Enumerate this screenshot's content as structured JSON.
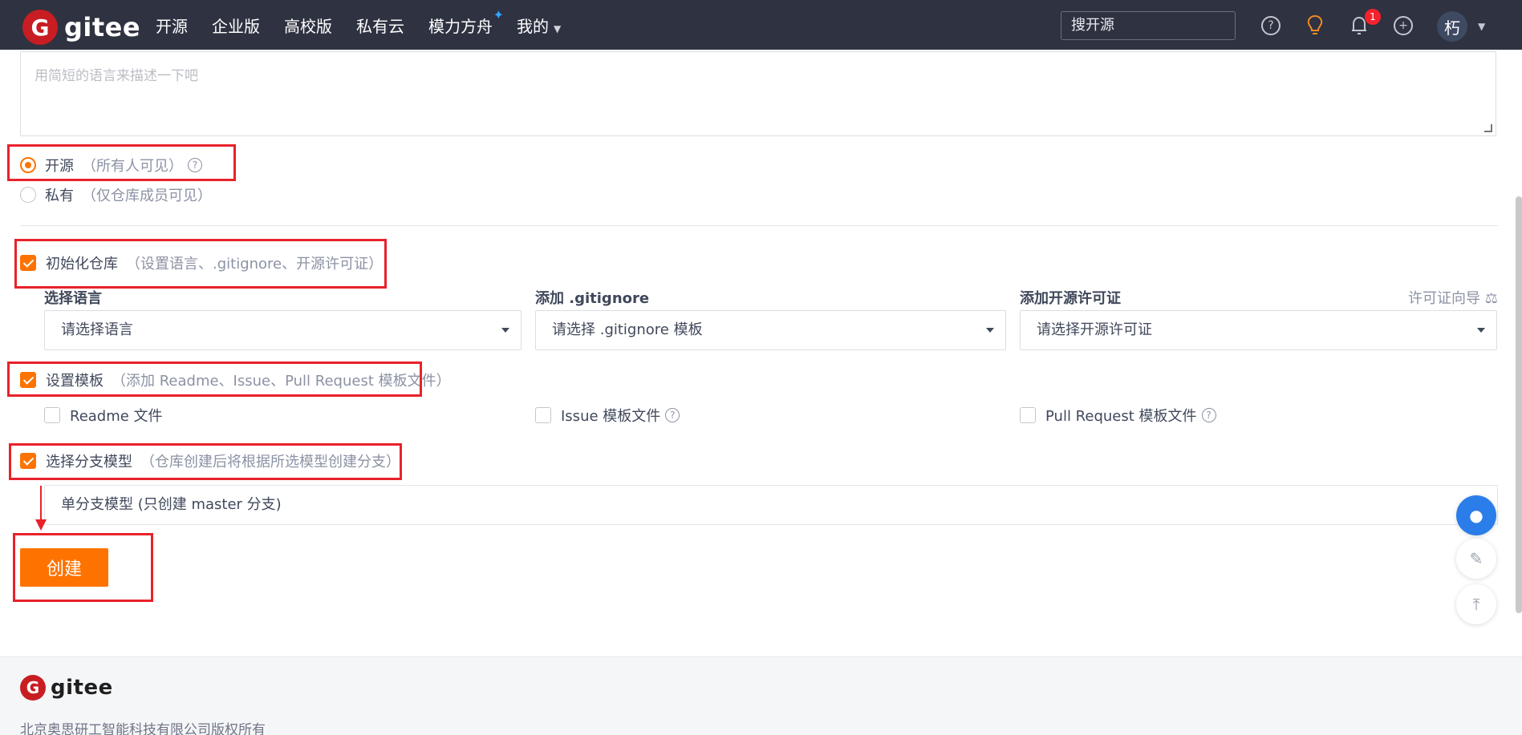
{
  "header": {
    "logo_text": "gitee",
    "logo_mark": "G",
    "nav": [
      "开源",
      "企业版",
      "高校版",
      "私有云",
      "模力方舟",
      "我的"
    ],
    "search_placeholder": "搜开源",
    "notification_count": "1",
    "avatar_text": "朽",
    "icons": [
      "help-icon",
      "bulb-icon",
      "bell-icon",
      "plus-icon",
      "chevron-down-icon"
    ]
  },
  "form": {
    "description_placeholder": "用简短的语言来描述一下吧",
    "visibility": {
      "public_label": "开源",
      "public_hint": "（所有人可见）",
      "private_label": "私有",
      "private_hint": "（仅仓库成员可见）",
      "selected": "public"
    },
    "init_repo": {
      "label": "初始化仓库",
      "hint": "（设置语言、.gitignore、开源许可证）",
      "checked": true,
      "language_label": "选择语言",
      "language_value": "请选择语言",
      "gitignore_label": "添加 .gitignore",
      "gitignore_value": "请选择 .gitignore 模板",
      "license_label": "添加开源许可证",
      "license_value": "请选择开源许可证",
      "license_guide": "许可证向导"
    },
    "template": {
      "label": "设置模板",
      "hint": "（添加 Readme、Issue、Pull Request 模板文件）",
      "checked": true,
      "readme": "Readme 文件",
      "issue": "Issue 模板文件",
      "pull_request": "Pull Request 模板文件"
    },
    "branch": {
      "label": "选择分支模型",
      "hint": "（仓库创建后将根据所选模型创建分支）",
      "checked": true,
      "value": "单分支模型 (只创建 master 分支)"
    },
    "create_button": "创建"
  },
  "footer": {
    "logo_text": "gitee",
    "copyright": "北京奥思研工智能科技有限公司版权所有"
  },
  "colors": {
    "accent": "#fe7300",
    "header_bg": "#2f3241",
    "annotation_red": "#e8222a"
  }
}
